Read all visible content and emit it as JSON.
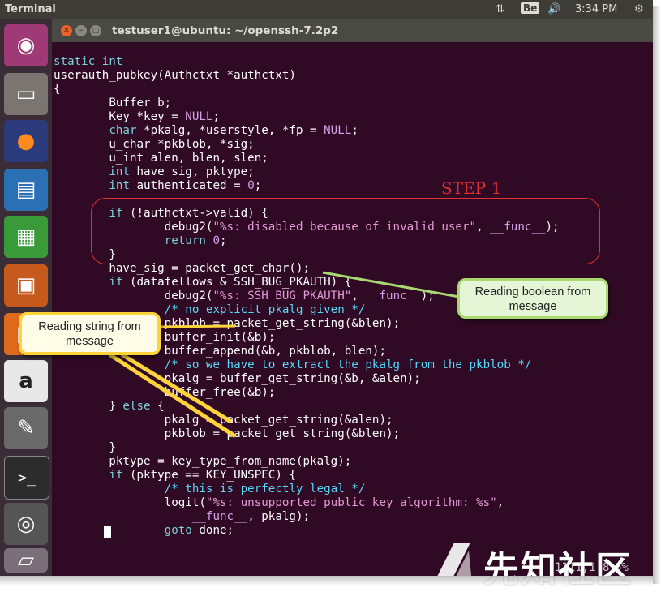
{
  "topbar": {
    "app_title": "Terminal",
    "keyboard_indicator": "Be",
    "clock": "3:34 PM"
  },
  "launcher": {
    "items": [
      {
        "name": "ubuntu-dash-icon",
        "color": "#a03a76"
      },
      {
        "name": "files-icon",
        "color": "#7a7570"
      },
      {
        "name": "firefox-icon",
        "color": "#d95b1d"
      },
      {
        "name": "writer-icon",
        "color": "#2b6fb5"
      },
      {
        "name": "calc-icon",
        "color": "#3a9a3a"
      },
      {
        "name": "impress-icon",
        "color": "#c55a1c"
      },
      {
        "name": "software-icon",
        "color": "#e06a1c"
      },
      {
        "name": "amazon-icon",
        "color": "#e8e8e8"
      },
      {
        "name": "settings-icon",
        "color": "#6a6a6a"
      },
      {
        "name": "terminal-icon",
        "color": "#2c2c2c"
      },
      {
        "name": "disk-icon",
        "color": "#555555"
      },
      {
        "name": "trash-icon",
        "color": "#7a6f78"
      }
    ]
  },
  "terminal": {
    "window_title": "testuser1@ubuntu: ~/openssh-7.2p2",
    "status_text": "1111,1 8",
    "status_percent": "6%"
  },
  "annotations": {
    "step_label": "STEP 1",
    "callout_boolean": "Reading boolean from message",
    "callout_string": "Reading string from message",
    "accent_red": "#e03131",
    "accent_green": "#a9d870",
    "accent_yellow": "#ffd43b"
  },
  "watermark": {
    "text": "先知社区"
  }
}
